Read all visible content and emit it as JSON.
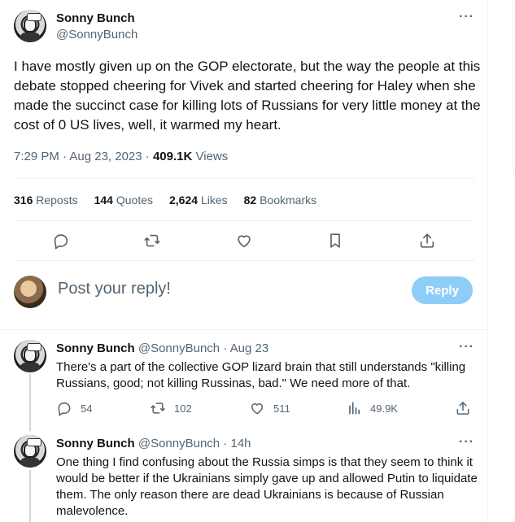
{
  "main_tweet": {
    "author_name": "Sonny Bunch",
    "author_handle": "@SonnyBunch",
    "more_icon": "···",
    "text": "I have mostly given up on the GOP electorate, but the way the people at this debate stopped cheering for Vivek and started cheering for Haley when she made the succinct case for killing lots of Russians for very little money at the cost of 0 US lives, well, it warmed my heart.",
    "time": "7:29 PM · Aug 23, 2023 · ",
    "views_count": "409.1K",
    "views_label": " Views"
  },
  "stats": [
    {
      "count": "316",
      "label": "Reposts"
    },
    {
      "count": "144",
      "label": "Quotes"
    },
    {
      "count": "2,624",
      "label": "Likes"
    },
    {
      "count": "82",
      "label": "Bookmarks"
    }
  ],
  "composer": {
    "placeholder": "Post your reply!",
    "reply_button": "Reply"
  },
  "replies": [
    {
      "author_name": "Sonny Bunch",
      "author_handle": "@SonnyBunch",
      "time": " · Aug 23",
      "more_icon": "···",
      "text": "There's a part of the collective GOP lizard brain that still understands \"killing Russians, good; not killing Russinas, bad.\" We need more of that.",
      "reply_count": "54",
      "repost_count": "102",
      "like_count": "511",
      "view_count": "49.9K"
    },
    {
      "author_name": "Sonny Bunch",
      "author_handle": "@SonnyBunch",
      "time": " · 14h",
      "more_icon": "···",
      "text": "One thing I find confusing about the Russia simps is that they seem to think it would be better if the Ukrainians simply gave up and allowed Putin to liquidate them. The only reason there are dead Ukrainians is because of Russian malevolence."
    }
  ],
  "colors": {
    "text": "#0f1419",
    "secondary": "#536471",
    "border": "#eff3f4",
    "reply_button": "#8ecdf8"
  },
  "icons": [
    "reply-icon",
    "repost-icon",
    "like-icon",
    "bookmark-icon",
    "share-icon",
    "analytics-icon",
    "more-icon"
  ]
}
